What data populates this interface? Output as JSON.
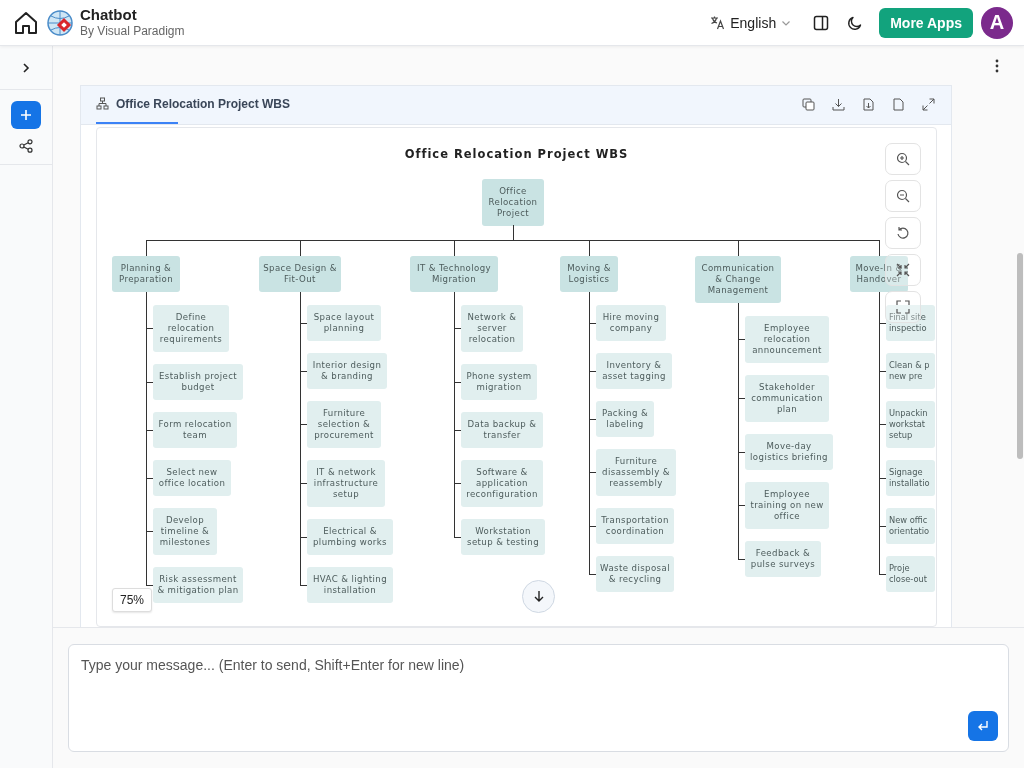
{
  "header": {
    "title": "Chatbot",
    "subtitle": "By Visual Paradigm",
    "language": "English",
    "more_apps": "More Apps",
    "avatar": "A"
  },
  "panel": {
    "tab": "Office Relocation Project WBS",
    "zoom": "75%"
  },
  "wbs": {
    "title": "Office Relocation Project WBS",
    "root": "Office Relocation Project",
    "branches": [
      {
        "label": "Planning & Preparation",
        "children": [
          "Define relocation requirements",
          "Establish project budget",
          "Form relocation team",
          "Select new office location",
          "Develop timeline & milestones",
          "Risk assessment & mitigation plan"
        ]
      },
      {
        "label": "Space Design & Fit-Out",
        "children": [
          "Space layout planning",
          "Interior design & branding",
          "Furniture selection & procurement",
          "IT & network infrastructure setup",
          "Electrical & plumbing works",
          "HVAC & lighting installation"
        ]
      },
      {
        "label": "IT & Technology Migration",
        "children": [
          "Network & server relocation",
          "Phone system migration",
          "Data backup & transfer",
          "Software & application reconfiguration",
          "Workstation setup & testing"
        ]
      },
      {
        "label": "Moving & Logistics",
        "children": [
          "Hire moving company",
          "Inventory & asset tagging",
          "Packing & labeling",
          "Furniture disassembly & reassembly",
          "Transportation coordination",
          "Waste disposal & recycling"
        ]
      },
      {
        "label": "Communication & Change Management",
        "children": [
          "Employee relocation announcement",
          "Stakeholder communication plan",
          "Move-day logistics briefing",
          "Employee training on new office",
          "Feedback & pulse surveys"
        ]
      },
      {
        "label": "Move-In & Handover",
        "children": [
          "Final site inspectio",
          "Clean & p new pre",
          "Unpackin workstat setup",
          "Signage installatio",
          "New offic orientatio",
          "Proje close-out"
        ]
      }
    ]
  },
  "chat": {
    "placeholder": "Type your message... (Enter to send, Shift+Enter for new line)"
  }
}
